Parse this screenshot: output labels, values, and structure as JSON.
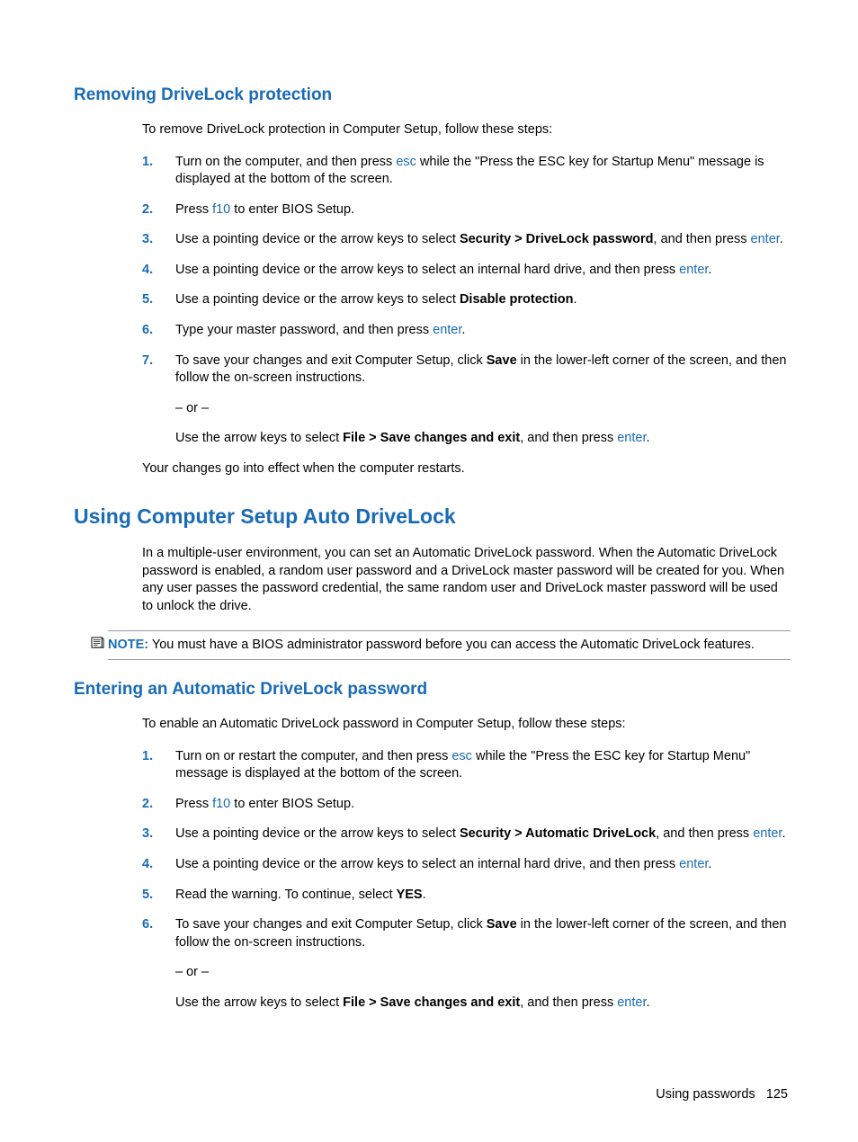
{
  "section1": {
    "heading": "Removing DriveLock protection",
    "intro": "To remove DriveLock protection in Computer Setup, follow these steps:",
    "step1_a": "Turn on the computer, and then press ",
    "step1_kbd": "esc",
    "step1_b": " while the \"Press the ESC key for Startup Menu\" message is displayed at the bottom of the screen.",
    "step2_a": "Press ",
    "step2_kbd": "f10",
    "step2_b": " to enter BIOS Setup.",
    "step3_a": "Use a pointing device or the arrow keys to select ",
    "step3_bold": "Security > DriveLock password",
    "step3_b": ", and then press ",
    "step3_kbd": "enter",
    "step3_c": ".",
    "step4_a": "Use a pointing device or the arrow keys to select an internal hard drive, and then press ",
    "step4_kbd": "enter",
    "step4_b": ".",
    "step5_a": "Use a pointing device or the arrow keys to select ",
    "step5_bold": "Disable protection",
    "step5_b": ".",
    "step6_a": "Type your master password, and then press ",
    "step6_kbd": "enter",
    "step6_b": ".",
    "step7_a": "To save your changes and exit Computer Setup, click ",
    "step7_bold1": "Save",
    "step7_b": " in the lower-left corner of the screen, and then follow the on-screen instructions.",
    "step7_or": "– or –",
    "step7_c": "Use the arrow keys to select ",
    "step7_bold2": "File > Save changes and exit",
    "step7_d": ", and then press ",
    "step7_kbd": "enter",
    "step7_e": ".",
    "outro": "Your changes go into effect when the computer restarts."
  },
  "section2": {
    "heading": "Using Computer Setup Auto DriveLock",
    "intro": "In a multiple-user environment, you can set an Automatic DriveLock password. When the Automatic DriveLock password is enabled, a random user password and a DriveLock master password will be created for you. When any user passes the password credential, the same random user and DriveLock master password will be used to unlock the drive.",
    "note_label": "NOTE:",
    "note_text": "   You must have a BIOS administrator password before you can access the Automatic DriveLock features."
  },
  "section3": {
    "heading": "Entering an Automatic DriveLock password",
    "intro": "To enable an Automatic DriveLock password in Computer Setup, follow these steps:",
    "step1_a": "Turn on or restart the computer, and then press ",
    "step1_kbd": "esc",
    "step1_b": " while the \"Press the ESC key for Startup Menu\" message is displayed at the bottom of the screen.",
    "step2_a": "Press ",
    "step2_kbd": "f10",
    "step2_b": " to enter BIOS Setup.",
    "step3_a": "Use a pointing device or the arrow keys to select ",
    "step3_bold": "Security > Automatic DriveLock",
    "step3_b": ", and then press ",
    "step3_kbd": "enter",
    "step3_c": ".",
    "step4_a": "Use a pointing device or the arrow keys to select an internal hard drive, and then press ",
    "step4_kbd": "enter",
    "step4_b": ".",
    "step5_a": "Read the warning. To continue, select ",
    "step5_bold": "YES",
    "step5_b": ".",
    "step6_a": "To save your changes and exit Computer Setup, click ",
    "step6_bold1": "Save",
    "step6_b": " in the lower-left corner of the screen, and then follow the on-screen instructions.",
    "step6_or": "– or –",
    "step6_c": "Use the arrow keys to select ",
    "step6_bold2": "File > Save changes and exit",
    "step6_d": ", and then press ",
    "step6_kbd": "enter",
    "step6_e": "."
  },
  "footer": {
    "section": "Using passwords",
    "page": "125"
  }
}
